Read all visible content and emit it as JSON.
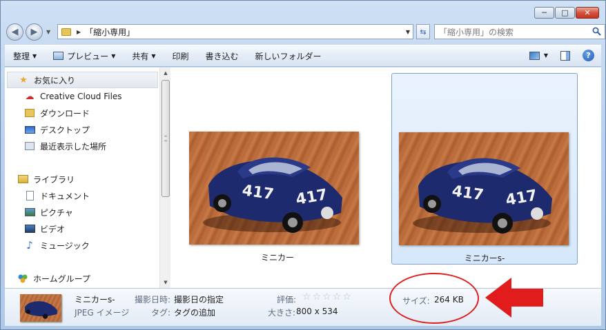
{
  "window": {
    "caption_buttons": {
      "minimize": "─",
      "maximize": "□",
      "close": "✕"
    }
  },
  "address_bar": {
    "path": "「縮小専用」",
    "search_placeholder": "「縮小専用」の検索"
  },
  "toolbar": {
    "organize": "整理",
    "preview": "プレビュー",
    "share": "共有",
    "print": "印刷",
    "burn": "書き込む",
    "new_folder": "新しいフォルダー"
  },
  "nav_pane": {
    "favorites": {
      "header": "お気に入り",
      "items": [
        "Creative Cloud Files",
        "ダウンロード",
        "デスクトップ",
        "最近表示した場所"
      ]
    },
    "libraries": {
      "header": "ライブラリ",
      "items": [
        "ドキュメント",
        "ピクチャ",
        "ビデオ",
        "ミュージック"
      ]
    },
    "homegroup": {
      "header": "ホームグループ"
    }
  },
  "files": [
    {
      "name": "ミニカー",
      "selected": false
    },
    {
      "name": "ミニカーs-",
      "selected": true
    }
  ],
  "thumbnail_number": "417",
  "details": {
    "name": "ミニカーs-",
    "type": "JPEG イメージ",
    "date_taken_label": "撮影日時:",
    "date_taken_value": "撮影日の指定",
    "tags_label": "タグ:",
    "tags_value": "タグの追加",
    "rating_label": "評価:",
    "rating_stars": 0,
    "dimensions_label": "大きさ:",
    "dimensions_value": "800 x 534",
    "size_label": "サイズ:",
    "size_value": "264 KB"
  },
  "colors": {
    "annotation": "#e01c1c",
    "selection_border": "#7da2ce",
    "car_body": "#1d2a6e"
  }
}
